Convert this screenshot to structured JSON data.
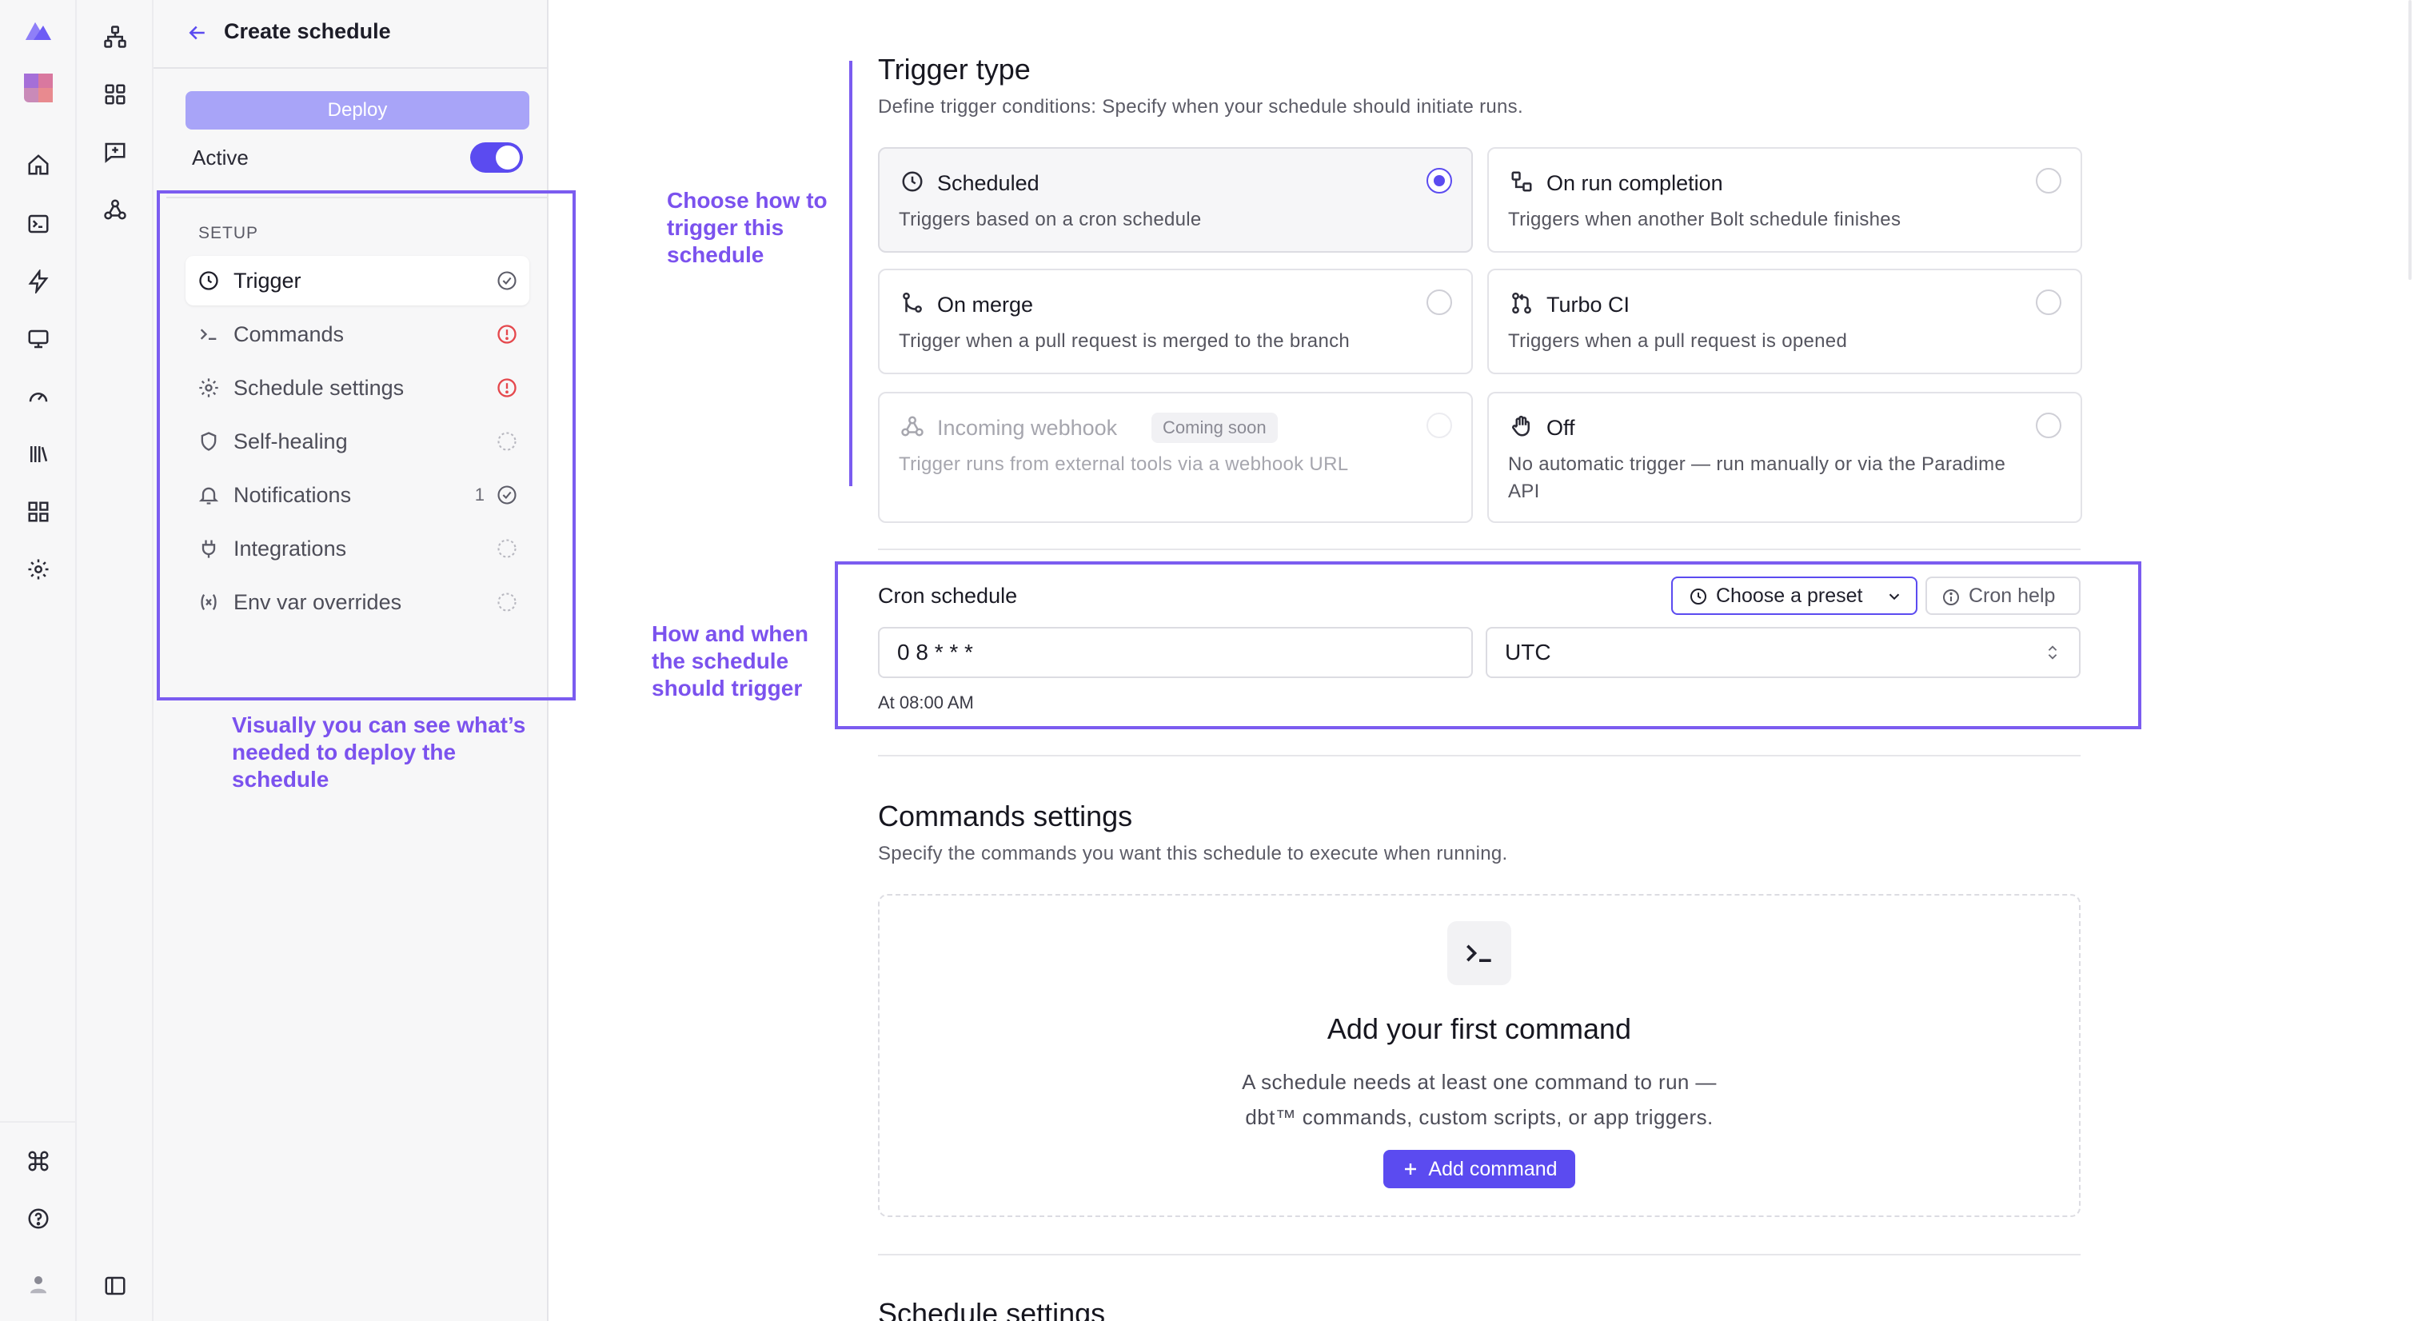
{
  "header": {
    "title": "Create schedule"
  },
  "sidebar": {
    "deploy_label": "Deploy",
    "active_label": "Active",
    "active_on": true,
    "section_label": "SETUP",
    "items": [
      {
        "label": "Trigger",
        "icon": "clock-icon",
        "status": "complete"
      },
      {
        "label": "Commands",
        "icon": "terminal-icon",
        "status": "error"
      },
      {
        "label": "Schedule settings",
        "icon": "gear-icon",
        "status": "error"
      },
      {
        "label": "Self-healing",
        "icon": "shield-icon",
        "status": "pending"
      },
      {
        "label": "Notifications",
        "icon": "bell-icon",
        "status": "complete",
        "count": "1"
      },
      {
        "label": "Integrations",
        "icon": "plug-icon",
        "status": "pending"
      },
      {
        "label": "Env var overrides",
        "icon": "variable-icon",
        "status": "pending"
      }
    ]
  },
  "annotations": {
    "sidebar_note": "Visually you can see what’s needed to deploy the schedule",
    "trigger_note": "Choose how to trigger this schedule",
    "cron_note": "How and when the schedule should trigger",
    "color": "#7b5cf0"
  },
  "trigger": {
    "title": "Trigger type",
    "subtitle": "Define trigger conditions: Specify when your schedule should initiate runs.",
    "options": [
      {
        "title": "Scheduled",
        "desc": "Triggers based on a cron schedule",
        "selected": true
      },
      {
        "title": "On run completion",
        "desc": "Triggers when another Bolt schedule finishes",
        "selected": false
      },
      {
        "title": "On merge",
        "desc": "Trigger when a pull request is merged to the branch",
        "selected": false
      },
      {
        "title": "Turbo CI",
        "desc": "Triggers when a pull request is opened",
        "selected": false
      },
      {
        "title": "Incoming webhook",
        "badge": "Coming soon",
        "desc": "Trigger runs from external tools via a webhook URL",
        "selected": false,
        "disabled": true
      },
      {
        "title": "Off",
        "desc": "No automatic trigger — run manually or via the Paradime API",
        "selected": false
      }
    ]
  },
  "cron": {
    "label": "Cron schedule",
    "preset_label": "Choose a preset",
    "help_label": "Cron help",
    "expression": "0 8 * * *",
    "timezone": "UTC",
    "hint": "At 08:00 AM"
  },
  "commands": {
    "title": "Commands settings",
    "subtitle": "Specify the commands you want this schedule to execute when running.",
    "empty_title": "Add your first command",
    "empty_desc_1": "A schedule needs at least one command to run —",
    "empty_desc_2": "dbt™ commands, custom scripts, or app triggers.",
    "add_label": "Add command"
  },
  "schedule_settings": {
    "title": "Schedule settings"
  },
  "colors": {
    "accent": "#5b4bf0",
    "error": "#e5484d",
    "annotation": "#7b5cf0"
  }
}
